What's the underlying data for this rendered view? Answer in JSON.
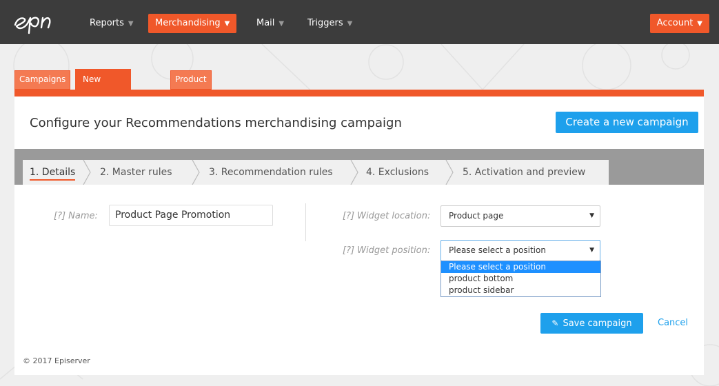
{
  "nav": {
    "logo_alt": "epi",
    "items": [
      {
        "label": "Reports",
        "active": false
      },
      {
        "label": "Merchandising",
        "active": true
      },
      {
        "label": "Mail",
        "active": false
      },
      {
        "label": "Triggers",
        "active": false
      }
    ],
    "account_label": "Account"
  },
  "tabs": [
    {
      "label": "Campaigns",
      "active": false
    },
    {
      "label": "New campaign",
      "active": true
    },
    {
      "label": "Product sets",
      "active": false
    }
  ],
  "page": {
    "title": "Configure your Recommendations merchandising campaign",
    "create_button": "Create a new campaign"
  },
  "steps": [
    {
      "label": "1. Details",
      "active": true
    },
    {
      "label": "2. Master rules",
      "active": false
    },
    {
      "label": "3. Recommendation rules",
      "active": false
    },
    {
      "label": "4. Exclusions",
      "active": false
    },
    {
      "label": "5. Activation and preview",
      "active": false
    }
  ],
  "form": {
    "name_label": "[?]  Name:",
    "name_value": "Product Page Promotion",
    "widget_location_label": "[?]  Widget location:",
    "widget_location_value": "Product page",
    "widget_position_label": "[?]  Widget position:",
    "widget_position_value": "Please select a position",
    "widget_position_options": [
      {
        "label": "Please select a position",
        "selected": true
      },
      {
        "label": "product bottom",
        "selected": false
      },
      {
        "label": "product sidebar",
        "selected": false
      }
    ]
  },
  "actions": {
    "save_label": "Save campaign",
    "cancel_label": "Cancel"
  },
  "footer": {
    "copyright": "© 2017 Episerver"
  },
  "colors": {
    "brand_orange": "#f0582a",
    "primary_blue": "#1ea0ec",
    "nav_bg": "#3c3c3c"
  }
}
